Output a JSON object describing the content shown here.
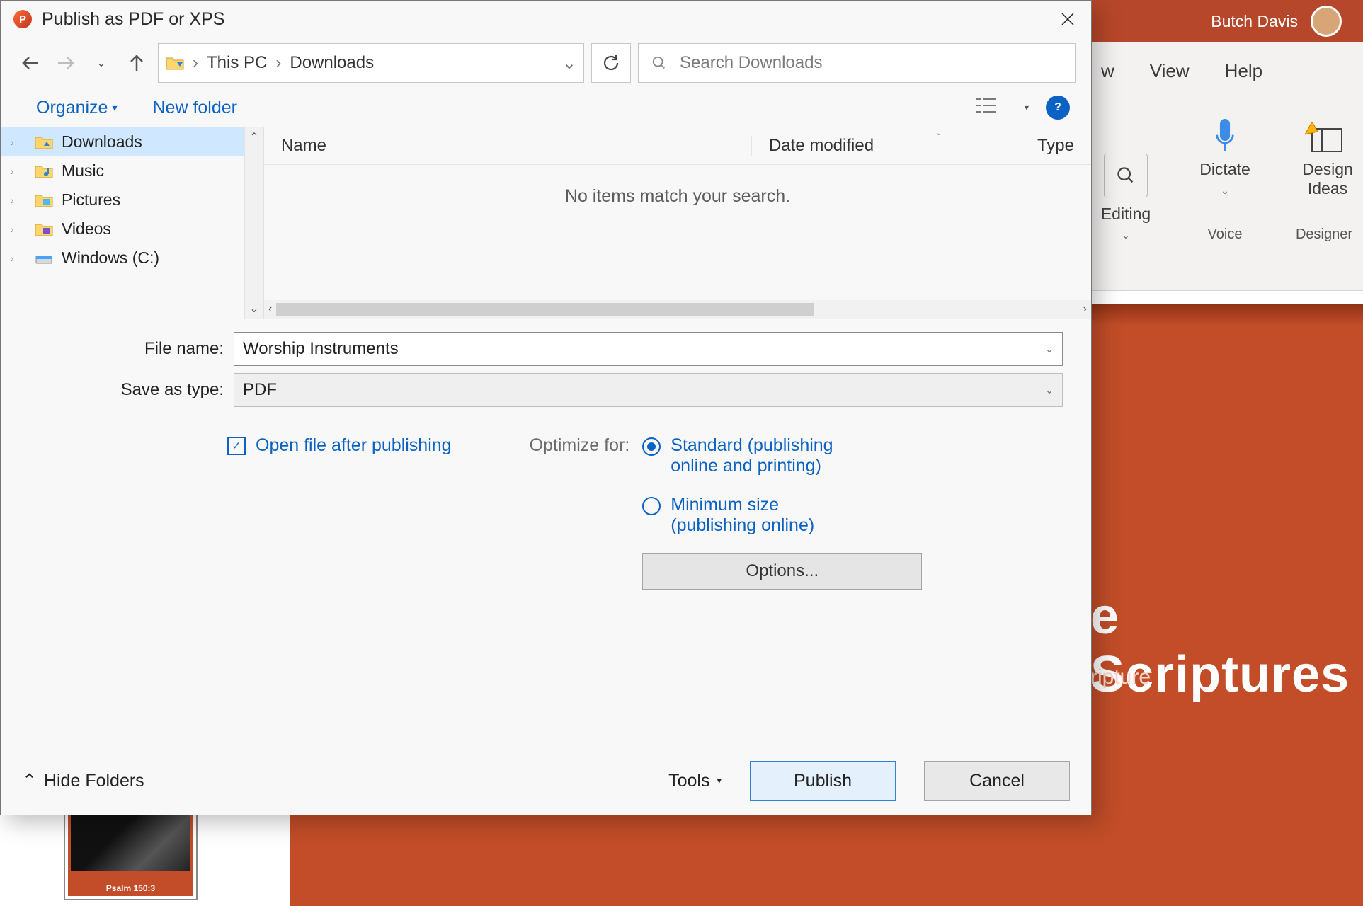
{
  "app_title": {
    "user": "Butch Davis"
  },
  "ribbon": {
    "tabs": [
      "w",
      "View",
      "Help"
    ],
    "tools": [
      {
        "name": "Editing",
        "icon": "search"
      },
      {
        "name": "Dictate",
        "icon": "mic",
        "group": "Voice"
      },
      {
        "name": "Design Ideas",
        "icon": "design",
        "group": "Designer"
      }
    ]
  },
  "slide": {
    "title": "e Scriptures",
    "sub": "ripture",
    "thumb_caption": "Psalm 150:3"
  },
  "dialog": {
    "title": "Publish as PDF or XPS",
    "breadcrumb": [
      "This PC",
      "Downloads"
    ],
    "search_placeholder": "Search Downloads",
    "toolbar": {
      "organize": "Organize",
      "newfolder": "New folder"
    },
    "tree": [
      {
        "label": "Downloads",
        "selected": true
      },
      {
        "label": "Music"
      },
      {
        "label": "Pictures"
      },
      {
        "label": "Videos"
      },
      {
        "label": "Windows (C:)"
      }
    ],
    "columns": {
      "name": "Name",
      "date": "Date modified",
      "type": "Type"
    },
    "empty": "No items match your search.",
    "filename_label": "File name:",
    "filename_value": "Worship Instruments",
    "savetype_label": "Save as type:",
    "savetype_value": "PDF",
    "open_after": "Open file after publishing",
    "optimize_label": "Optimize for:",
    "opt_standard": "Standard (publishing online and printing)",
    "opt_min": "Minimum size (publishing online)",
    "options_btn": "Options...",
    "hide_folders": "Hide Folders",
    "tools_label": "Tools",
    "publish": "Publish",
    "cancel": "Cancel"
  }
}
